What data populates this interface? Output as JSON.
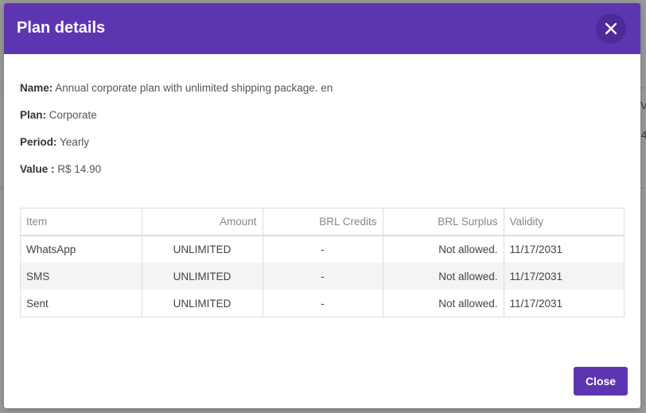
{
  "modal": {
    "title": "Plan details",
    "close_label": "Close"
  },
  "details": [
    {
      "label": "Name:",
      "value": "Annual corporate plan with unlimited shipping package. en"
    },
    {
      "label": "Plan:",
      "value": "Corporate"
    },
    {
      "label": "Period:",
      "value": "Yearly"
    },
    {
      "label": "Value :",
      "value": "R$ 14.90"
    }
  ],
  "table": {
    "headers": [
      "Item",
      "Amount",
      "BRL Credits",
      "BRL Surplus",
      "Validity"
    ],
    "rows": [
      [
        "WhatsApp",
        "UNLIMITED",
        "-",
        "Not allowed.",
        "11/17/2031"
      ],
      [
        "SMS",
        "UNLIMITED",
        "-",
        "Not allowed.",
        "11/17/2031"
      ],
      [
        "Sent",
        "UNLIMITED",
        "-",
        "Not allowed.",
        "11/17/2031"
      ]
    ]
  },
  "background": {
    "edge_glyphs": [
      "Va",
      "4"
    ]
  },
  "colors": {
    "accent": "#5e35b1"
  }
}
